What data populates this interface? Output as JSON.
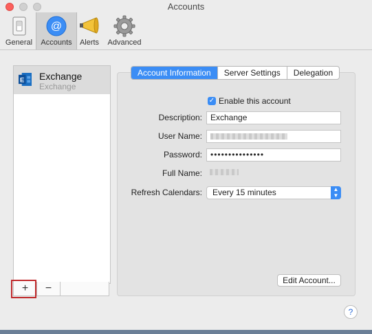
{
  "window": {
    "title": "Accounts"
  },
  "toolbar": {
    "items": [
      {
        "label": "General",
        "icon": "light-switch-icon"
      },
      {
        "label": "Accounts",
        "icon": "at-sign-icon",
        "selected": true
      },
      {
        "label": "Alerts",
        "icon": "megaphone-icon"
      },
      {
        "label": "Advanced",
        "icon": "gear-icon"
      }
    ]
  },
  "accounts": [
    {
      "name": "Exchange",
      "type": "Exchange",
      "icon": "exchange-logo-icon"
    }
  ],
  "list_buttons": {
    "add": "+",
    "remove": "−"
  },
  "tabs": [
    {
      "label": "Account Information",
      "active": true
    },
    {
      "label": "Server Settings",
      "active": false
    },
    {
      "label": "Delegation",
      "active": false
    }
  ],
  "form": {
    "enable_label": "Enable this account",
    "enable_checked": true,
    "description_label": "Description:",
    "description_value": "Exchange",
    "username_label": "User Name:",
    "password_label": "Password:",
    "password_value": "•••••••••••••••",
    "fullname_label": "Full Name:",
    "refresh_label": "Refresh Calendars:",
    "refresh_value": "Every 15 minutes"
  },
  "edit_account_label": "Edit Account...",
  "help_label": "?",
  "colors": {
    "accent": "#3b8df5",
    "highlight": "#c0282a",
    "close": "#fc605c"
  }
}
